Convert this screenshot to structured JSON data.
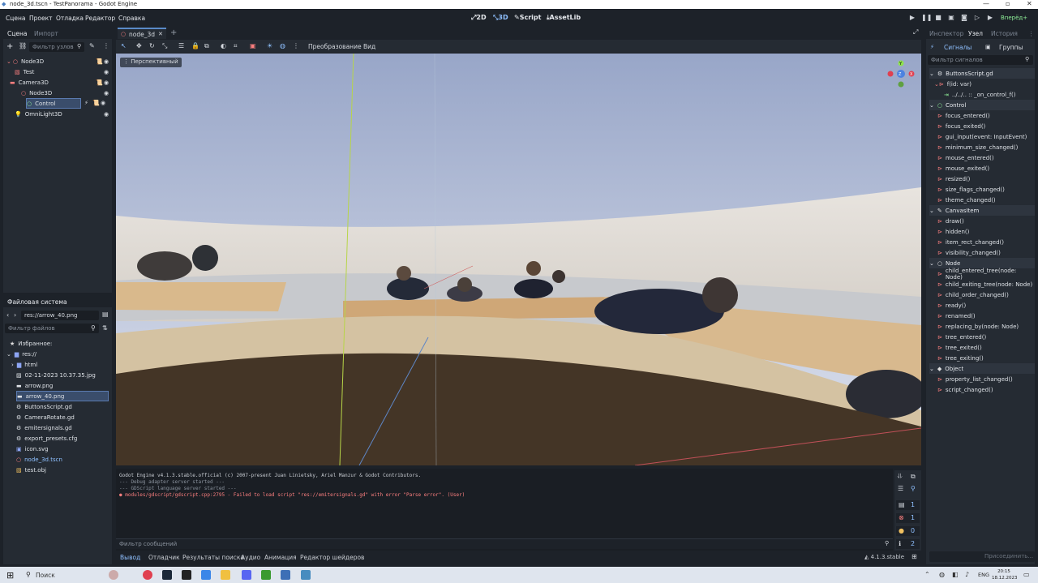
{
  "window": {
    "title": "node_3d.tscn - TestPanorama - Godot Engine"
  },
  "menu": [
    "Сцена",
    "Проект",
    "Отладка",
    "Редактор",
    "Справка"
  ],
  "workspaces": [
    "2D",
    "3D",
    "Script",
    "AssetLib"
  ],
  "renderer": "Вперёд+",
  "scene_panel": {
    "tabs": [
      "Сцена",
      "Импорт"
    ],
    "filter_placeholder": "Фильтр узлов",
    "nodes": [
      {
        "label": "Node3D"
      },
      {
        "label": "Test"
      },
      {
        "label": "Camera3D"
      },
      {
        "label": "Node3D"
      },
      {
        "label": "Control"
      },
      {
        "label": "OmniLight3D"
      }
    ]
  },
  "filesystem": {
    "title": "Файловая система",
    "path": "res://arrow_40.png",
    "filter_placeholder": "Фильтр файлов",
    "favorites": "Избранное:",
    "root": "res://",
    "items": [
      "html",
      "02-11-2023 10.37.35.jpg",
      "arrow.png",
      "arrow_40.png",
      "ButtonsScript.gd",
      "CameraRotate.gd",
      "emitersignals.gd",
      "export_presets.cfg",
      "icon.svg",
      "node_3d.tscn",
      "test.obj"
    ]
  },
  "editor_tabs": {
    "scene_tab": "node_3d"
  },
  "toolbar": {
    "transform_menu": "Преобразование",
    "view_menu": "Вид"
  },
  "viewport": {
    "perspective_label": "Перспективный"
  },
  "output": {
    "lines": [
      "Godot Engine v4.1.3.stable.official (c) 2007-present Juan Linietsky, Ariel Manzur & Godot Contributors.",
      "--- Debug adapter server started ---",
      "--- GDScript language server started ---",
      "modules/gdscript/gdscript.cpp:2795 - Failed to load script \"res://emitersignals.gd\" with error \"Parse error\". (User)"
    ],
    "filter_placeholder": "Фильтр сообщений",
    "counts": {
      "log": "1",
      "errors": "1",
      "warnings": "0",
      "info": "2"
    }
  },
  "bottom_tabs": [
    "Вывод",
    "Отладчик",
    "Результаты поиска",
    "Аудио",
    "Анимация",
    "Редактор шейдеров"
  ],
  "version": "4.1.3.stable",
  "inspector": {
    "tabs": [
      "Инспектор",
      "Узел",
      "История"
    ],
    "subtabs": [
      "Сигналы",
      "Группы"
    ],
    "filter_placeholder": "Фильтр сигналов",
    "script": "ButtonsScript.gd",
    "script_method": "f(id: var)",
    "connection": "../../.. :: _on_control_f()",
    "sections": [
      {
        "name": "Control",
        "signals": [
          "focus_entered()",
          "focus_exited()",
          "gui_input(event: InputEvent)",
          "minimum_size_changed()",
          "mouse_entered()",
          "mouse_exited()",
          "resized()",
          "size_flags_changed()",
          "theme_changed()"
        ]
      },
      {
        "name": "CanvasItem",
        "signals": [
          "draw()",
          "hidden()",
          "item_rect_changed()",
          "visibility_changed()"
        ]
      },
      {
        "name": "Node",
        "signals": [
          "child_entered_tree(node: Node)",
          "child_exiting_tree(node: Node)",
          "child_order_changed()",
          "ready()",
          "renamed()",
          "replacing_by(node: Node)",
          "tree_entered()",
          "tree_exited()",
          "tree_exiting()"
        ]
      },
      {
        "name": "Object",
        "signals": [
          "property_list_changed()",
          "script_changed()"
        ]
      }
    ],
    "connect_button": "Присоединить..."
  },
  "taskbar": {
    "search": "Поиск",
    "lang": "ENG",
    "time": "20:15",
    "date": "18.12.2023"
  }
}
